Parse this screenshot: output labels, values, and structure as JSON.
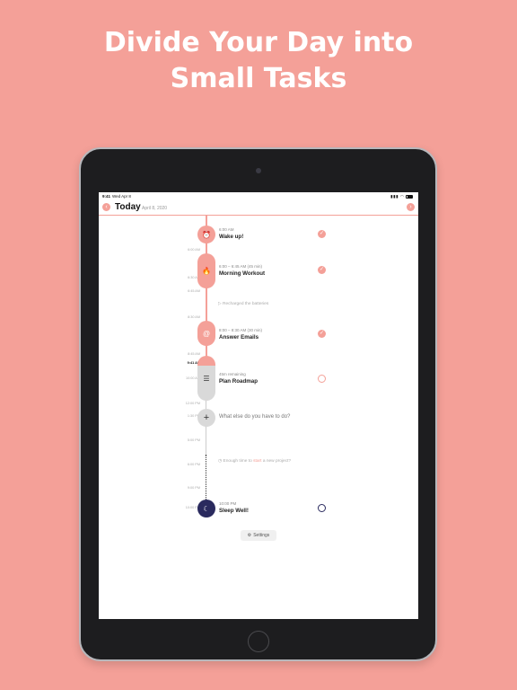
{
  "headline": {
    "line1": "Divide Your Day into",
    "line2": "Small Tasks"
  },
  "status": {
    "time": "9:41",
    "date": "Wed Apr 8",
    "signal_icon": "signal-wifi-battery"
  },
  "header": {
    "title": "Today",
    "date": "April 8, 2020",
    "back_icon": "chevron-left-icon",
    "forward_icon": "chevron-right-icon"
  },
  "time_ticks": [
    "6:00 AM",
    "6:30 AM",
    "6:45 AM",
    "8:30 AM",
    "8:45 AM",
    "9:41 AM",
    "10:00 AM",
    "12:00 PM",
    "1:30 PM",
    "5:00 PM",
    "6:00 PM",
    "9:00 PM",
    "10:00 PM"
  ],
  "tasks": [
    {
      "sub": "6:00 AM",
      "title": "Wake up!",
      "icon": "alarm-icon",
      "done": true
    },
    {
      "sub": "6:00 – 6:45 AM (45 min)",
      "title": "Morning Workout",
      "icon": "flame-icon",
      "done": true
    },
    {
      "sub": "8:00 – 8:30 AM (30 min)",
      "title": "Answer Emails",
      "icon": "at-sign-icon",
      "done": true
    },
    {
      "sub": "45m remaining",
      "title": "Plan Roadmap",
      "icon": "list-icon",
      "done": false
    },
    {
      "sub": "10:00 PM",
      "title": "Sleep Well!",
      "icon": "moon-bed-icon",
      "done": false
    }
  ],
  "hints": {
    "recharged": "Recharged the batteries",
    "enough_time_pre": "Enough time to",
    "enough_time_accent": "start",
    "enough_time_post": "a new project?"
  },
  "add_prompt": "What else do you have to do?",
  "settings_label": "Settings",
  "colors": {
    "accent": "#f4a098",
    "navy": "#2a2a5e"
  }
}
